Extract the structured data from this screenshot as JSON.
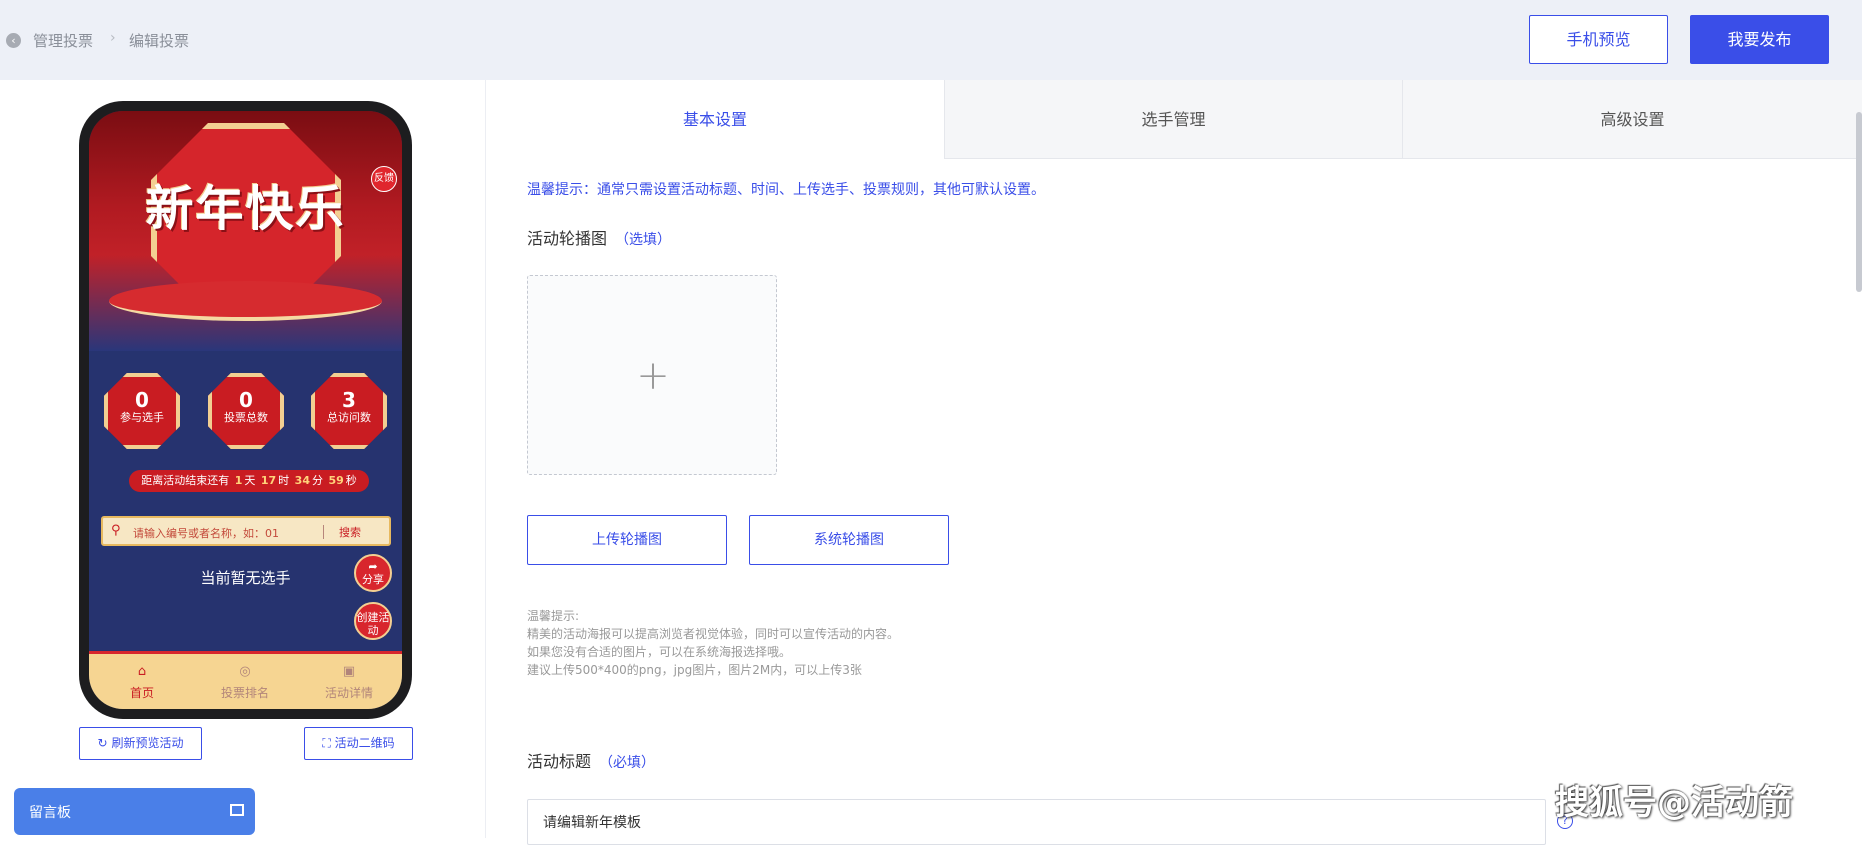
{
  "header": {
    "breadcrumb": [
      "管理投票",
      "编辑投票"
    ],
    "preview_label": "手机预览",
    "publish_label": "我要发布"
  },
  "phone": {
    "banner_text": "新年快乐",
    "feedback_label": "反馈",
    "stats": [
      {
        "value": "0",
        "label": "参与选手"
      },
      {
        "value": "0",
        "label": "投票总数"
      },
      {
        "value": "3",
        "label": "总访问数"
      }
    ],
    "countdown": {
      "prefix": "距离活动结束还有",
      "days": "1",
      "day_unit": "天",
      "hours": "17",
      "hour_unit": "时",
      "minutes": "34",
      "minute_unit": "分",
      "seconds": "59",
      "second_unit": "秒"
    },
    "search_placeholder": "请输入编号或者名称，如：01",
    "search_button": "搜索",
    "share_label": "分享",
    "create_label": "创建活动",
    "empty_text": "当前暂无选手",
    "tabbar": [
      "首页",
      "投票排名",
      "活动详情"
    ],
    "refresh_label": "刷新预览活动",
    "qr_label": "活动二维码"
  },
  "message_board": {
    "label": "留言板"
  },
  "tabs": [
    "基本设置",
    "选手管理",
    "高级设置"
  ],
  "tip": "温馨提示：通常只需设置活动标题、时间、上传选手、投票规则，其他可默认设置。",
  "carousel": {
    "label": "活动轮播图",
    "note": "（选填）",
    "upload_label": "上传轮播图",
    "system_label": "系统轮播图",
    "help": [
      "温馨提示:",
      "精美的活动海报可以提高浏览者视觉体验，同时可以宣传活动的内容。",
      "如果您没有合适的图片，可以在系统海报选择哦。",
      "建议上传500*400的png，jpg图片，图片2M内，可以上传3张"
    ]
  },
  "activity_title": {
    "label": "活动标题",
    "note": "（必填）",
    "value": "请编辑新年模板"
  },
  "watermark": "搜狐号@活动箭",
  "colors": {
    "accent": "#3a4ee8",
    "header_bg": "#edf0f7",
    "festive_red": "#c91c22"
  }
}
